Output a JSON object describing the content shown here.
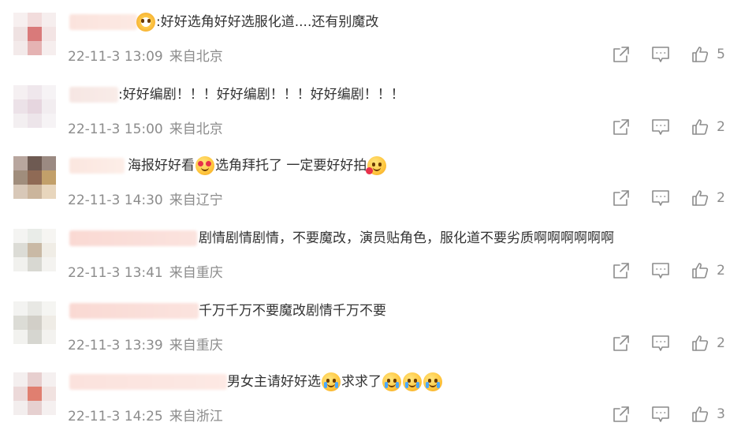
{
  "comments": [
    {
      "text_before": "",
      "text_after": ":好好选角好好选服化道....还有别魔改",
      "date": "22-11-3 13:09",
      "location": "来自北京",
      "likes": "5",
      "emojis_before": [
        "eyes-emoji"
      ],
      "avatar": [
        "#f7f0f0",
        "#f2dcdc",
        "#f6eeee",
        "#efe2e2",
        "#d97a7a",
        "#f3e4e4",
        "#f3eaea",
        "#e5b3b3",
        "#f6eeee"
      ],
      "name_blur": [
        "#fbe3dd",
        "#fde9e3"
      ]
    },
    {
      "text_before": "",
      "text_after": ":好好编剧！！！好好编剧！！！好好编剧！！！",
      "date": "22-11-3 15:00",
      "location": "来自北京",
      "likes": "2",
      "emojis_before": [],
      "avatar": [
        "#f5f0f2",
        "#efe7ec",
        "#f6f3f5",
        "#ece2e8",
        "#e6d6df",
        "#f2edf0",
        "#f3eff1",
        "#ede5ea",
        "#f6f3f5"
      ],
      "name_blur": [
        "#f6e6e3",
        "#f9ece8"
      ]
    },
    {
      "text_before": "海报好好看",
      "text_after": "选角拜托了 一定要好好拍",
      "date": "22-11-3 14:30",
      "location": "来自辽宁",
      "likes": "2",
      "emojis_mid": [
        "heart-eyes-emoji"
      ],
      "emojis_end": [
        "pleading-heart-emoji"
      ],
      "avatar": [
        "#b8a69e",
        "#6e5a52",
        "#9b8a82",
        "#a08d7c",
        "#8f6a55",
        "#c2a06a",
        "#d8c8b8",
        "#cbb59c",
        "#e8d6bd"
      ],
      "name_blur": [
        "#fbe6df",
        "#fdeee8"
      ]
    },
    {
      "text_before": "",
      "text_after": "剧情剧情剧情，不要魔改，演员贴角色，服化道不要劣质啊啊啊啊啊啊",
      "date": "22-11-3 13:41",
      "location": "来自重庆",
      "likes": "2",
      "emojis_before": [],
      "avatar": [
        "#f4f4f2",
        "#e9ece8",
        "#f6f5f2",
        "#dcdcd6",
        "#c9b9a5",
        "#f0ede6",
        "#f1f1ee",
        "#d8d8d2",
        "#f4f3f0"
      ],
      "name_blur": [
        "#fad9d3",
        "#fbe3de"
      ]
    },
    {
      "text_before": "",
      "text_after": "千万千万不要魔改剧情千万不要",
      "date": "22-11-3 13:39",
      "location": "来自重庆",
      "likes": "2",
      "emojis_before": [],
      "avatar": [
        "#f3f3f1",
        "#e8e8e4",
        "#f5f5f2",
        "#dcdcd6",
        "#d2cfc8",
        "#efece6",
        "#f2f2ef",
        "#d6d6d0",
        "#f3f2ef"
      ],
      "name_blur": [
        "#fad9d3",
        "#fbe3de"
      ]
    },
    {
      "text_before": "男女主请好好选",
      "text_after": "求求了",
      "date": "22-11-3 14:25",
      "location": "来自浙江",
      "likes": "3",
      "emojis_mid": [
        "crying-emoji"
      ],
      "emojis_end": [
        "crying-emoji",
        "crying-emoji",
        "crying-emoji"
      ],
      "avatar": [
        "#f4efef",
        "#e7cfcf",
        "#f5f0f0",
        "#ecd9d9",
        "#e07f70",
        "#f1e2e0",
        "#f3eeee",
        "#e6d0d0",
        "#f5f0f0"
      ],
      "name_blur": [
        "#fbe2dd",
        "#fde9e4"
      ]
    }
  ],
  "icons": {
    "share": "share-icon",
    "comment": "comment-icon",
    "like": "like-icon"
  }
}
